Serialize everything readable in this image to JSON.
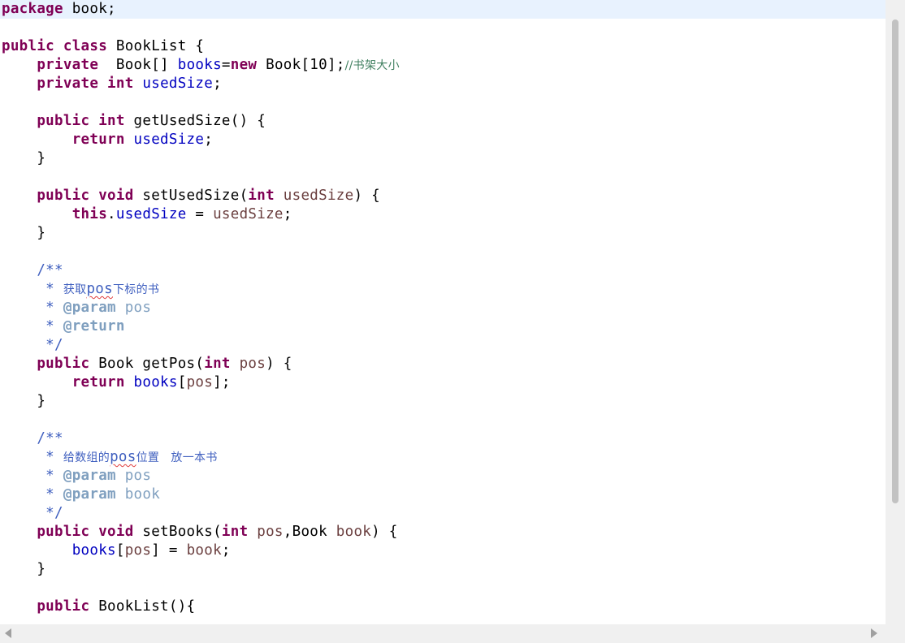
{
  "code": {
    "lines": [
      {
        "current": true,
        "tokens": [
          {
            "t": "package",
            "c": "kw"
          },
          {
            "t": " book;",
            "c": "plain"
          }
        ]
      },
      {
        "tokens": []
      },
      {
        "tokens": [
          {
            "t": "public",
            "c": "kw"
          },
          {
            "t": " ",
            "c": "plain"
          },
          {
            "t": "class",
            "c": "kw"
          },
          {
            "t": " BookList {",
            "c": "plain"
          }
        ]
      },
      {
        "tokens": [
          {
            "t": "    ",
            "c": "plain"
          },
          {
            "t": "private",
            "c": "kw"
          },
          {
            "t": "  Book[] ",
            "c": "plain"
          },
          {
            "t": "books",
            "c": "field"
          },
          {
            "t": "=",
            "c": "plain"
          },
          {
            "t": "new",
            "c": "kw"
          },
          {
            "t": " Book[10];",
            "c": "plain"
          },
          {
            "t": "//书架大小",
            "c": "comment"
          }
        ]
      },
      {
        "tokens": [
          {
            "t": "    ",
            "c": "plain"
          },
          {
            "t": "private",
            "c": "kw"
          },
          {
            "t": " ",
            "c": "plain"
          },
          {
            "t": "int",
            "c": "kw"
          },
          {
            "t": " ",
            "c": "plain"
          },
          {
            "t": "usedSize",
            "c": "field"
          },
          {
            "t": ";",
            "c": "plain"
          }
        ]
      },
      {
        "tokens": []
      },
      {
        "tokens": [
          {
            "t": "    ",
            "c": "plain"
          },
          {
            "t": "public",
            "c": "kw"
          },
          {
            "t": " ",
            "c": "plain"
          },
          {
            "t": "int",
            "c": "kw"
          },
          {
            "t": " getUsedSize() {",
            "c": "plain"
          }
        ]
      },
      {
        "tokens": [
          {
            "t": "        ",
            "c": "plain"
          },
          {
            "t": "return",
            "c": "kw"
          },
          {
            "t": " ",
            "c": "plain"
          },
          {
            "t": "usedSize",
            "c": "field"
          },
          {
            "t": ";",
            "c": "plain"
          }
        ]
      },
      {
        "tokens": [
          {
            "t": "    }",
            "c": "plain"
          }
        ]
      },
      {
        "tokens": []
      },
      {
        "tokens": [
          {
            "t": "    ",
            "c": "plain"
          },
          {
            "t": "public",
            "c": "kw"
          },
          {
            "t": " ",
            "c": "plain"
          },
          {
            "t": "void",
            "c": "kw"
          },
          {
            "t": " setUsedSize(",
            "c": "plain"
          },
          {
            "t": "int",
            "c": "kw"
          },
          {
            "t": " ",
            "c": "plain"
          },
          {
            "t": "usedSize",
            "c": "param"
          },
          {
            "t": ") {",
            "c": "plain"
          }
        ]
      },
      {
        "tokens": [
          {
            "t": "        ",
            "c": "plain"
          },
          {
            "t": "this",
            "c": "kw"
          },
          {
            "t": ".",
            "c": "plain"
          },
          {
            "t": "usedSize",
            "c": "field"
          },
          {
            "t": " = ",
            "c": "plain"
          },
          {
            "t": "usedSize",
            "c": "param"
          },
          {
            "t": ";",
            "c": "plain"
          }
        ]
      },
      {
        "tokens": [
          {
            "t": "    }",
            "c": "plain"
          }
        ]
      },
      {
        "tokens": []
      },
      {
        "tokens": [
          {
            "t": "    /**",
            "c": "javadoc"
          }
        ]
      },
      {
        "tokens": [
          {
            "t": "     * ",
            "c": "javadoc"
          },
          {
            "t": "获取",
            "c": "cjk"
          },
          {
            "t": "pos",
            "c": "cjk-mono",
            "warn": true
          },
          {
            "t": "下标的书",
            "c": "cjk"
          }
        ]
      },
      {
        "tokens": [
          {
            "t": "     * ",
            "c": "javadoc"
          },
          {
            "t": "@param",
            "c": "jdtag"
          },
          {
            "t": " pos",
            "c": "jdname"
          }
        ]
      },
      {
        "tokens": [
          {
            "t": "     * ",
            "c": "javadoc"
          },
          {
            "t": "@return",
            "c": "jdtag"
          }
        ]
      },
      {
        "tokens": [
          {
            "t": "     */",
            "c": "javadoc"
          }
        ]
      },
      {
        "tokens": [
          {
            "t": "    ",
            "c": "plain"
          },
          {
            "t": "public",
            "c": "kw"
          },
          {
            "t": " Book getPos(",
            "c": "plain"
          },
          {
            "t": "int",
            "c": "kw"
          },
          {
            "t": " ",
            "c": "plain"
          },
          {
            "t": "pos",
            "c": "param"
          },
          {
            "t": ") {",
            "c": "plain"
          }
        ]
      },
      {
        "tokens": [
          {
            "t": "        ",
            "c": "plain"
          },
          {
            "t": "return",
            "c": "kw"
          },
          {
            "t": " ",
            "c": "plain"
          },
          {
            "t": "books",
            "c": "field"
          },
          {
            "t": "[",
            "c": "plain"
          },
          {
            "t": "pos",
            "c": "param"
          },
          {
            "t": "];",
            "c": "plain"
          }
        ]
      },
      {
        "tokens": [
          {
            "t": "    }",
            "c": "plain"
          }
        ]
      },
      {
        "tokens": []
      },
      {
        "tokens": [
          {
            "t": "    /**",
            "c": "javadoc"
          }
        ]
      },
      {
        "tokens": [
          {
            "t": "     * ",
            "c": "javadoc"
          },
          {
            "t": "给数组的",
            "c": "cjk"
          },
          {
            "t": "pos",
            "c": "cjk-mono",
            "warn": true
          },
          {
            "t": "位置   放一本书",
            "c": "cjk"
          }
        ]
      },
      {
        "tokens": [
          {
            "t": "     * ",
            "c": "javadoc"
          },
          {
            "t": "@param",
            "c": "jdtag"
          },
          {
            "t": " pos",
            "c": "jdname"
          }
        ]
      },
      {
        "tokens": [
          {
            "t": "     * ",
            "c": "javadoc"
          },
          {
            "t": "@param",
            "c": "jdtag"
          },
          {
            "t": " book",
            "c": "jdname"
          }
        ]
      },
      {
        "tokens": [
          {
            "t": "     */",
            "c": "javadoc"
          }
        ]
      },
      {
        "tokens": [
          {
            "t": "    ",
            "c": "plain"
          },
          {
            "t": "public",
            "c": "kw"
          },
          {
            "t": " ",
            "c": "plain"
          },
          {
            "t": "void",
            "c": "kw"
          },
          {
            "t": " setBooks(",
            "c": "plain"
          },
          {
            "t": "int",
            "c": "kw"
          },
          {
            "t": " ",
            "c": "plain"
          },
          {
            "t": "pos",
            "c": "param"
          },
          {
            "t": ",Book ",
            "c": "plain"
          },
          {
            "t": "book",
            "c": "param"
          },
          {
            "t": ") {",
            "c": "plain"
          }
        ]
      },
      {
        "tokens": [
          {
            "t": "        ",
            "c": "plain"
          },
          {
            "t": "books",
            "c": "field"
          },
          {
            "t": "[",
            "c": "plain"
          },
          {
            "t": "pos",
            "c": "param"
          },
          {
            "t": "] = ",
            "c": "plain"
          },
          {
            "t": "book",
            "c": "param"
          },
          {
            "t": ";",
            "c": "plain"
          }
        ]
      },
      {
        "tokens": [
          {
            "t": "    }",
            "c": "plain"
          }
        ]
      },
      {
        "tokens": []
      },
      {
        "tokens": [
          {
            "t": "    ",
            "c": "plain"
          },
          {
            "t": "public",
            "c": "kw"
          },
          {
            "t": " BookList(){",
            "c": "plain"
          }
        ]
      }
    ]
  },
  "scrollbars": {
    "left_arrow_icon": "triangle-left-icon",
    "right_arrow_icon": "triangle-right-icon"
  }
}
